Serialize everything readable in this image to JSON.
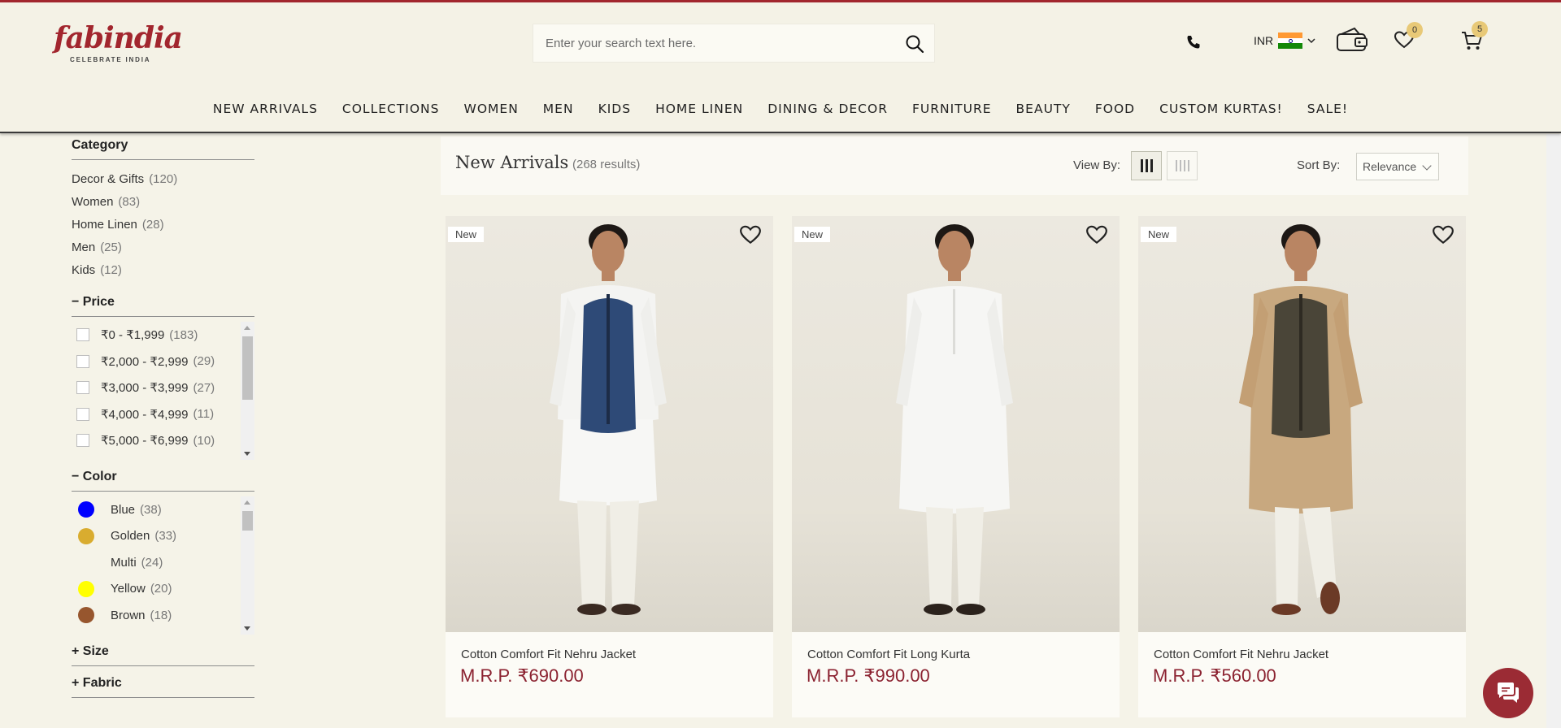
{
  "brand": {
    "logo_text": "fabindia",
    "tagline": "CELEBRATE INDIA"
  },
  "search": {
    "placeholder": "Enter your search text here."
  },
  "header": {
    "currency": "INR",
    "wishlist_count": "0",
    "cart_count": "5"
  },
  "nav": [
    "NEW ARRIVALS",
    "COLLECTIONS",
    "WOMEN",
    "MEN",
    "KIDS",
    "HOME LINEN",
    "DINING & DECOR",
    "FURNITURE",
    "BEAUTY",
    "FOOD",
    "CUSTOM KURTAS!",
    "SALE!"
  ],
  "filters": {
    "category": {
      "title": "Category",
      "items": [
        {
          "label": "Decor & Gifts",
          "count": "(120)"
        },
        {
          "label": "Women",
          "count": "(83)"
        },
        {
          "label": "Home Linen",
          "count": "(28)"
        },
        {
          "label": "Men",
          "count": "(25)"
        },
        {
          "label": "Kids",
          "count": "(12)"
        }
      ]
    },
    "price": {
      "title": "Price",
      "toggle": "−",
      "items": [
        {
          "label": "₹0 - ₹1,999",
          "count": "(183)"
        },
        {
          "label": "₹2,000 - ₹2,999",
          "count": "(29)"
        },
        {
          "label": "₹3,000 - ₹3,999",
          "count": "(27)"
        },
        {
          "label": "₹4,000 - ₹4,999",
          "count": "(11)"
        },
        {
          "label": "₹5,000 - ₹6,999",
          "count": "(10)"
        }
      ]
    },
    "color": {
      "title": "Color",
      "toggle": "−",
      "items": [
        {
          "label": "Blue",
          "count": "(38)",
          "swatch": "#0000ff"
        },
        {
          "label": "Golden",
          "count": "(33)",
          "swatch": "#d9ac2f"
        },
        {
          "label": "Multi",
          "count": "(24)",
          "swatch": ""
        },
        {
          "label": "Yellow",
          "count": "(20)",
          "swatch": "#ffff00"
        },
        {
          "label": "Brown",
          "count": "(18)",
          "swatch": "#97562e"
        }
      ]
    },
    "size": {
      "title": "Size",
      "toggle": "+"
    },
    "fabric": {
      "title": "Fabric",
      "toggle": "+"
    }
  },
  "results": {
    "title": "New Arrivals",
    "count": "(268 results)",
    "view_by_label": "View By:",
    "sort_by_label": "Sort By:",
    "sort_value": "Relevance"
  },
  "products": [
    {
      "tag": "New",
      "name": "Cotton Comfort Fit Nehru Jacket",
      "price": "M.R.P. ₹690.00",
      "jacket_color": "#2e4a77",
      "kurta_color": "#f4f4f2"
    },
    {
      "tag": "New",
      "name": "Cotton Comfort Fit Long Kurta",
      "price": "M.R.P. ₹990.00",
      "jacket_color": "",
      "kurta_color": "#f6f6f4"
    },
    {
      "tag": "New",
      "name": "Cotton Comfort Fit Nehru Jacket",
      "price": "M.R.P. ₹560.00",
      "jacket_color": "#4a4538",
      "kurta_color": "#c8a87f"
    }
  ],
  "colors": {
    "brand": "#a2262e",
    "price": "#8b2230",
    "badge": "#e8c977"
  }
}
